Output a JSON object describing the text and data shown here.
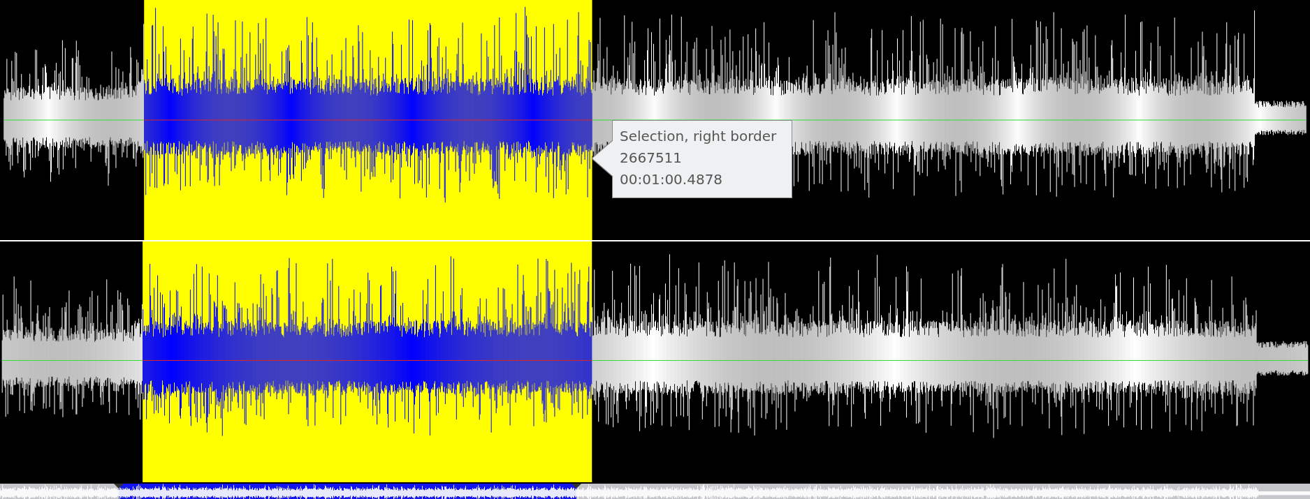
{
  "tooltip": {
    "lines": [
      "Selection, right border",
      "2667511",
      "00:01:00.4878"
    ]
  }
}
